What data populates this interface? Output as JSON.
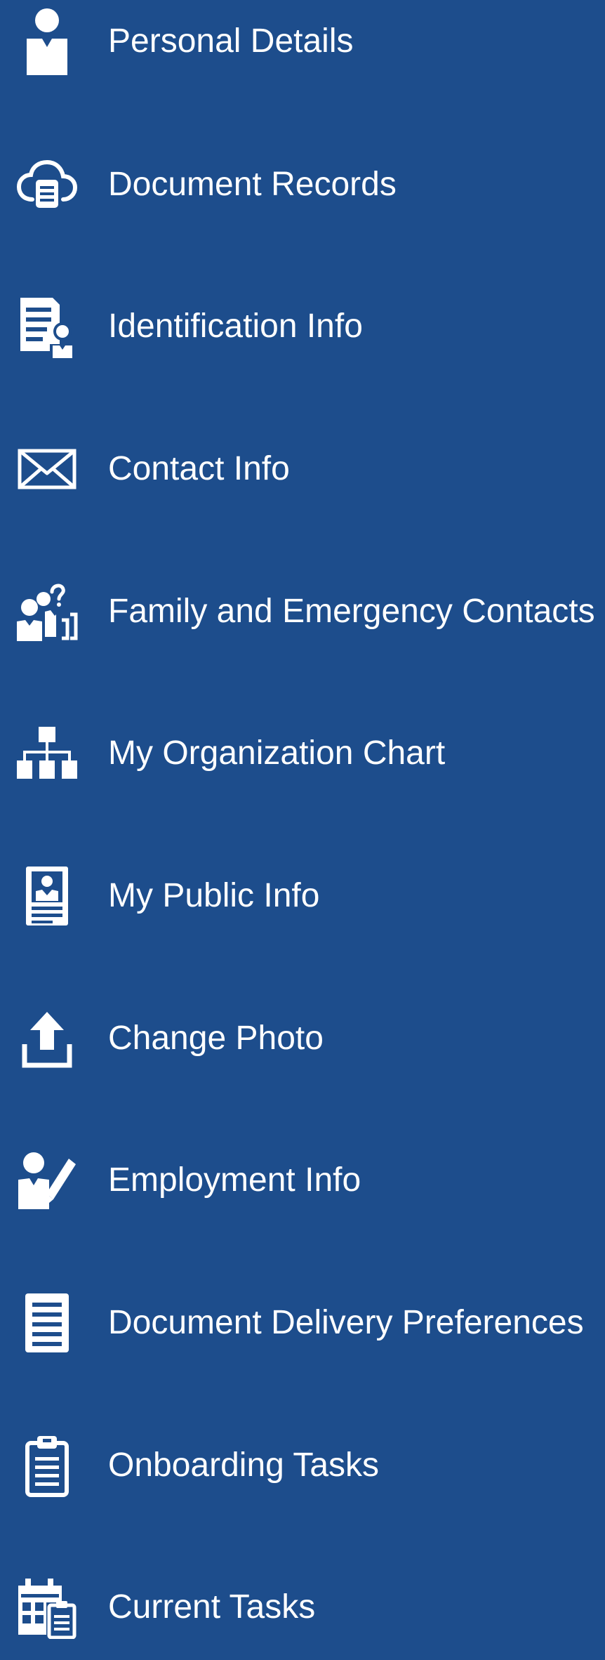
{
  "menu": {
    "items": [
      {
        "label": "Personal Details",
        "icon": "person-icon"
      },
      {
        "label": "Document Records",
        "icon": "cloud-document-icon"
      },
      {
        "label": "Identification Info",
        "icon": "id-document-icon"
      },
      {
        "label": "Contact Info",
        "icon": "envelope-icon"
      },
      {
        "label": "Family and Emergency Contacts",
        "icon": "family-contact-icon"
      },
      {
        "label": "My Organization Chart",
        "icon": "org-chart-icon"
      },
      {
        "label": "My Public Info",
        "icon": "id-badge-icon"
      },
      {
        "label": "Change Photo",
        "icon": "upload-icon"
      },
      {
        "label": "Employment Info",
        "icon": "person-pen-icon"
      },
      {
        "label": "Document Delivery Preferences",
        "icon": "document-list-icon"
      },
      {
        "label": "Onboarding Tasks",
        "icon": "clipboard-icon"
      },
      {
        "label": "Current Tasks",
        "icon": "calendar-tasks-icon"
      }
    ]
  },
  "colors": {
    "background": "#1d4d8c",
    "text": "#ffffff",
    "icon": "#ffffff"
  }
}
